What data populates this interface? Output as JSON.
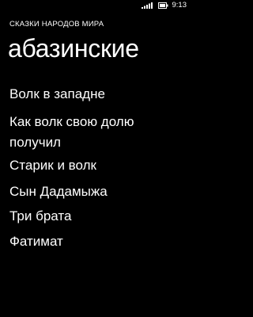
{
  "status_bar": {
    "time": "9:13",
    "icons": [
      "signal-icon",
      "battery-icon"
    ]
  },
  "header": {
    "app_title": "СКАЗКИ НАРОДОВ МИРА",
    "page_title": "абазинские"
  },
  "list": {
    "items": [
      {
        "line1": "Волк в западне",
        "line2": ""
      },
      {
        "line1": "Как волк свою долю",
        "line2": "получил"
      },
      {
        "line1": "Старик и волк",
        "line2": ""
      },
      {
        "line1": "Сын Дадамыжа",
        "line2": ""
      },
      {
        "line1": "Три брата",
        "line2": ""
      },
      {
        "line1": "Фатимат",
        "line2": ""
      }
    ]
  },
  "colors": {
    "background": "#000000",
    "foreground": "#ffffff"
  }
}
